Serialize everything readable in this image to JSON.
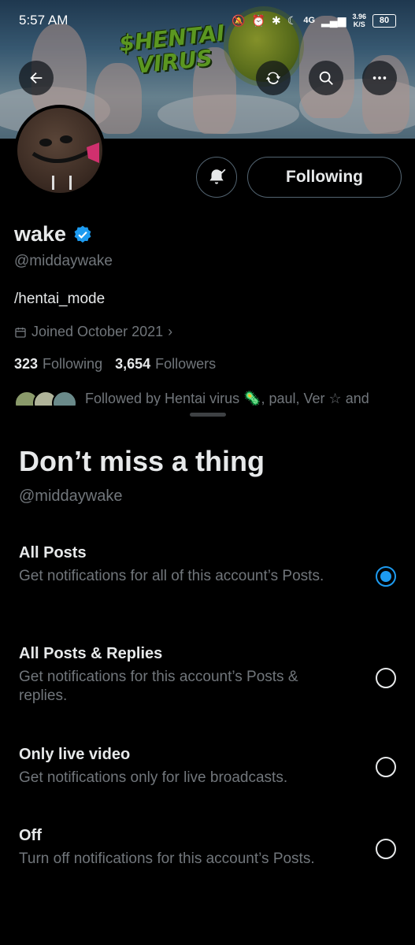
{
  "status_bar": {
    "time": "5:57 AM",
    "signal": "4G",
    "speed_value": "3.96",
    "speed_unit": "K/S",
    "battery": "80"
  },
  "banner": {
    "logo_text": "$HENTAI VIRUS"
  },
  "profile": {
    "name": "wake",
    "handle": "@middaywake",
    "bio": "/hentai_mode",
    "joined": "Joined October 2021",
    "following_count": "323",
    "following_label": "Following",
    "followers_count": "3,654",
    "followers_label": "Followers",
    "followed_by": "Followed by Hentai virus 🦠, paul, Ver ☆ and",
    "follow_button_label": "Following"
  },
  "sheet": {
    "title": "Don’t miss a thing",
    "handle": "@middaywake",
    "options": [
      {
        "title": "All Posts",
        "desc": "Get notifications for all of this account’s Posts.",
        "selected": true
      },
      {
        "title": "All Posts & Replies",
        "desc": "Get notifications for this account’s Posts & replies.",
        "selected": false
      },
      {
        "title": "Only live video",
        "desc": "Get notifications only for live broadcasts.",
        "selected": false
      },
      {
        "title": "Off",
        "desc": "Turn off notifications for this account’s Posts.",
        "selected": false
      }
    ]
  },
  "colors": {
    "accent": "#1d9bf0",
    "secondary_text": "#71767b",
    "primary_text": "#e7e9ea"
  },
  "icons": [
    "back-arrow-icon",
    "refresh-icon",
    "search-icon",
    "more-icon",
    "bell-icon",
    "verified-badge-icon",
    "calendar-icon",
    "chevron-right-icon"
  ]
}
